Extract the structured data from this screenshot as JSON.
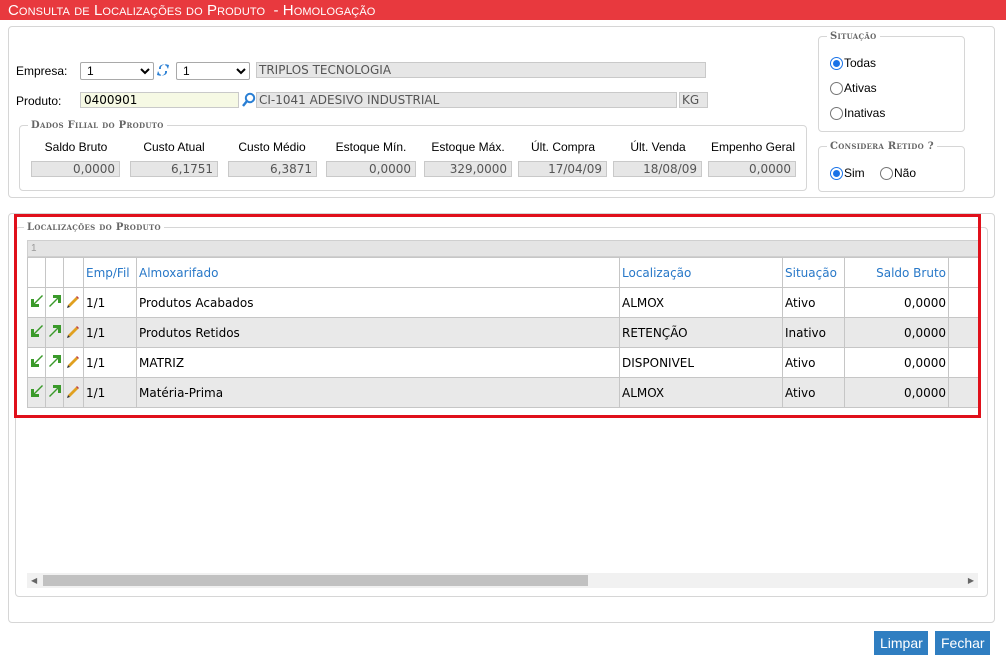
{
  "title": "Consulta de Localizações do Produto",
  "subtitle": " - Homologação",
  "empresa": {
    "label": "Empresa:",
    "select1": "1",
    "select2": "1",
    "name": "TRIPLOS TECNOLOGIA"
  },
  "produto": {
    "label": "Produto:",
    "code": "0400901",
    "description": "CI-1041 ADESIVO INDUSTRIAL",
    "unit": "KG"
  },
  "dados_filial": {
    "legend": "Dados Filial do Produto",
    "headers": [
      "Saldo Bruto",
      "Custo Atual",
      "Custo Médio",
      "Estoque Mín.",
      "Estoque Máx.",
      "Últ. Compra",
      "Últ. Venda",
      "Empenho Geral"
    ],
    "values": [
      "0,0000",
      "6,1751",
      "6,3871",
      "0,0000",
      "329,0000",
      "17/04/09",
      "18/08/09",
      "0,0000"
    ]
  },
  "situacao": {
    "legend": "Situação",
    "options": [
      "Todas",
      "Ativas",
      "Inativas"
    ],
    "selected": "Todas"
  },
  "considera_retido": {
    "legend": "Considera Retido ?",
    "options": [
      "Sim",
      "Não"
    ],
    "selected": "Sim"
  },
  "localizacoes": {
    "legend": "Localizações do Produto",
    "page": "1",
    "columns": [
      "Emp/Fil",
      "Almoxarifado",
      "Localização",
      "Situação",
      "Saldo Bruto"
    ],
    "rows": [
      {
        "empfil": "1/1",
        "almox": "Produtos Acabados",
        "local": "ALMOX",
        "situacao": "Ativo",
        "saldo": "0,0000"
      },
      {
        "empfil": "1/1",
        "almox": "Produtos Retidos",
        "local": "RETENÇÃO",
        "situacao": "Inativo",
        "saldo": "0,0000"
      },
      {
        "empfil": "1/1",
        "almox": "MATRIZ",
        "local": "DISPONIVEL",
        "situacao": "Ativo",
        "saldo": "0,0000"
      },
      {
        "empfil": "1/1",
        "almox": "Matéria-Prima",
        "local": "ALMOX",
        "situacao": "Ativo",
        "saldo": "0,0000"
      }
    ]
  },
  "buttons": {
    "limpar": "Limpar",
    "fechar": "Fechar"
  },
  "colors": {
    "title_bg": "#e8393e",
    "button_bg": "#2f7ec1",
    "link_blue": "#2878c8",
    "highlight_border": "#e0101b"
  }
}
